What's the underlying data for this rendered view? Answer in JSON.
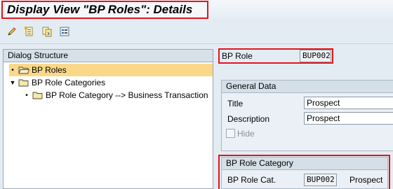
{
  "window": {
    "title": "Display View \"BP Roles\": Details"
  },
  "toolbar": {
    "icons": [
      "edit-icon",
      "new-entries-icon",
      "copy-icon",
      "other-entry-icon"
    ]
  },
  "dialog_structure": {
    "header": "Dialog Structure",
    "items": [
      {
        "label": "BP Roles",
        "level": 1,
        "selected": true
      },
      {
        "label": "BP Role Categories",
        "level": 1,
        "expanded": true
      },
      {
        "label": "BP Role Category --> Business Transaction",
        "level": 2
      }
    ]
  },
  "detail": {
    "bp_role_label": "BP Role",
    "bp_role_value": "BUP002",
    "general_data": {
      "title": "General Data",
      "title_label": "Title",
      "title_value": "Prospect",
      "description_label": "Description",
      "description_value": "Prospect",
      "hide_label": "Hide",
      "hide_checked": false
    },
    "role_category": {
      "title": "BP Role Category",
      "cat_label": "BP Role Cat.",
      "cat_value": "BUP002",
      "cat_text": "Prospect"
    }
  },
  "colors": {
    "highlight": "#e0161e",
    "selected_row": "#fad88a",
    "background": "#e4ecf3"
  }
}
